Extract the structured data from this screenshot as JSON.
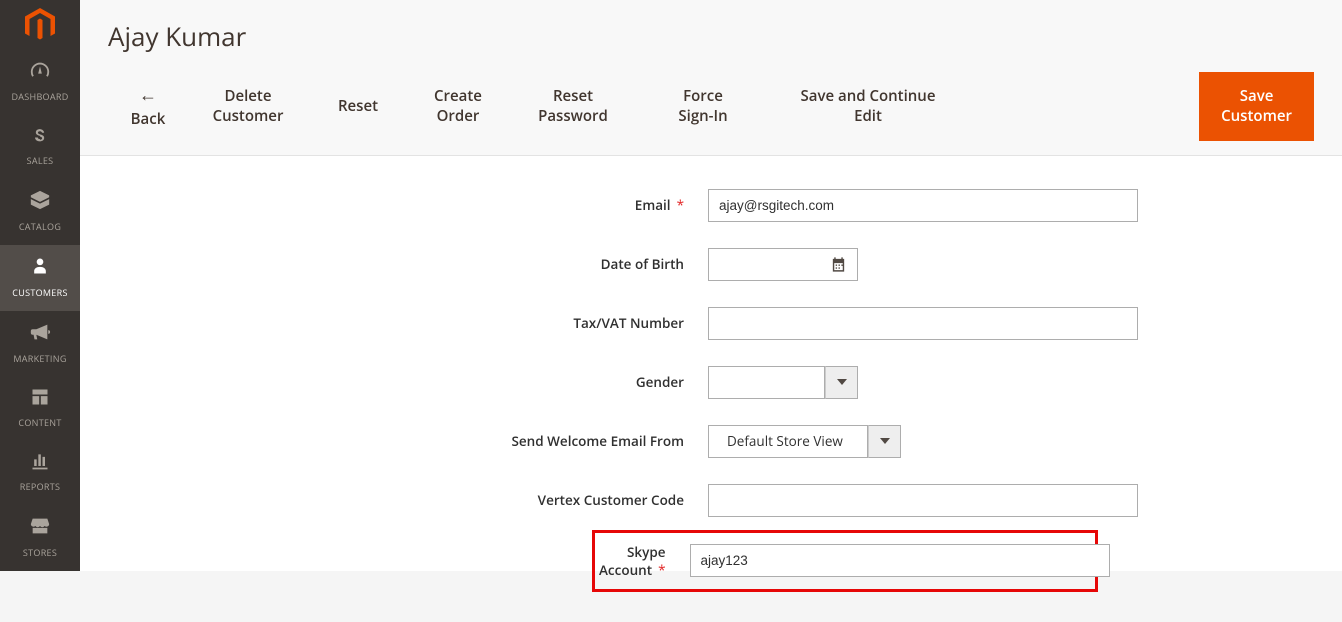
{
  "sidebar": {
    "items": [
      {
        "label": "DASHBOARD"
      },
      {
        "label": "SALES"
      },
      {
        "label": "CATALOG"
      },
      {
        "label": "CUSTOMERS"
      },
      {
        "label": "MARKETING"
      },
      {
        "label": "CONTENT"
      },
      {
        "label": "REPORTS"
      },
      {
        "label": "STORES"
      }
    ]
  },
  "page": {
    "title": "Ajay Kumar"
  },
  "actions": {
    "back": "Back",
    "delete": "Delete Customer",
    "reset": "Reset",
    "create_order": "Create Order",
    "reset_password": "Reset Password",
    "force_signin": "Force Sign-In",
    "save_continue": "Save and Continue Edit",
    "save": "Save Customer"
  },
  "form": {
    "email": {
      "label": "Email",
      "value": "ajay@rsgitech.com",
      "required": true
    },
    "dob": {
      "label": "Date of Birth",
      "value": ""
    },
    "taxvat": {
      "label": "Tax/VAT Number",
      "value": ""
    },
    "gender": {
      "label": "Gender",
      "value": ""
    },
    "send_welcome": {
      "label": "Send Welcome Email From",
      "value": "Default Store View"
    },
    "vertex": {
      "label": "Vertex Customer Code",
      "value": ""
    },
    "skype": {
      "label": "Skype Account",
      "value": "ajay123",
      "required": true
    }
  }
}
